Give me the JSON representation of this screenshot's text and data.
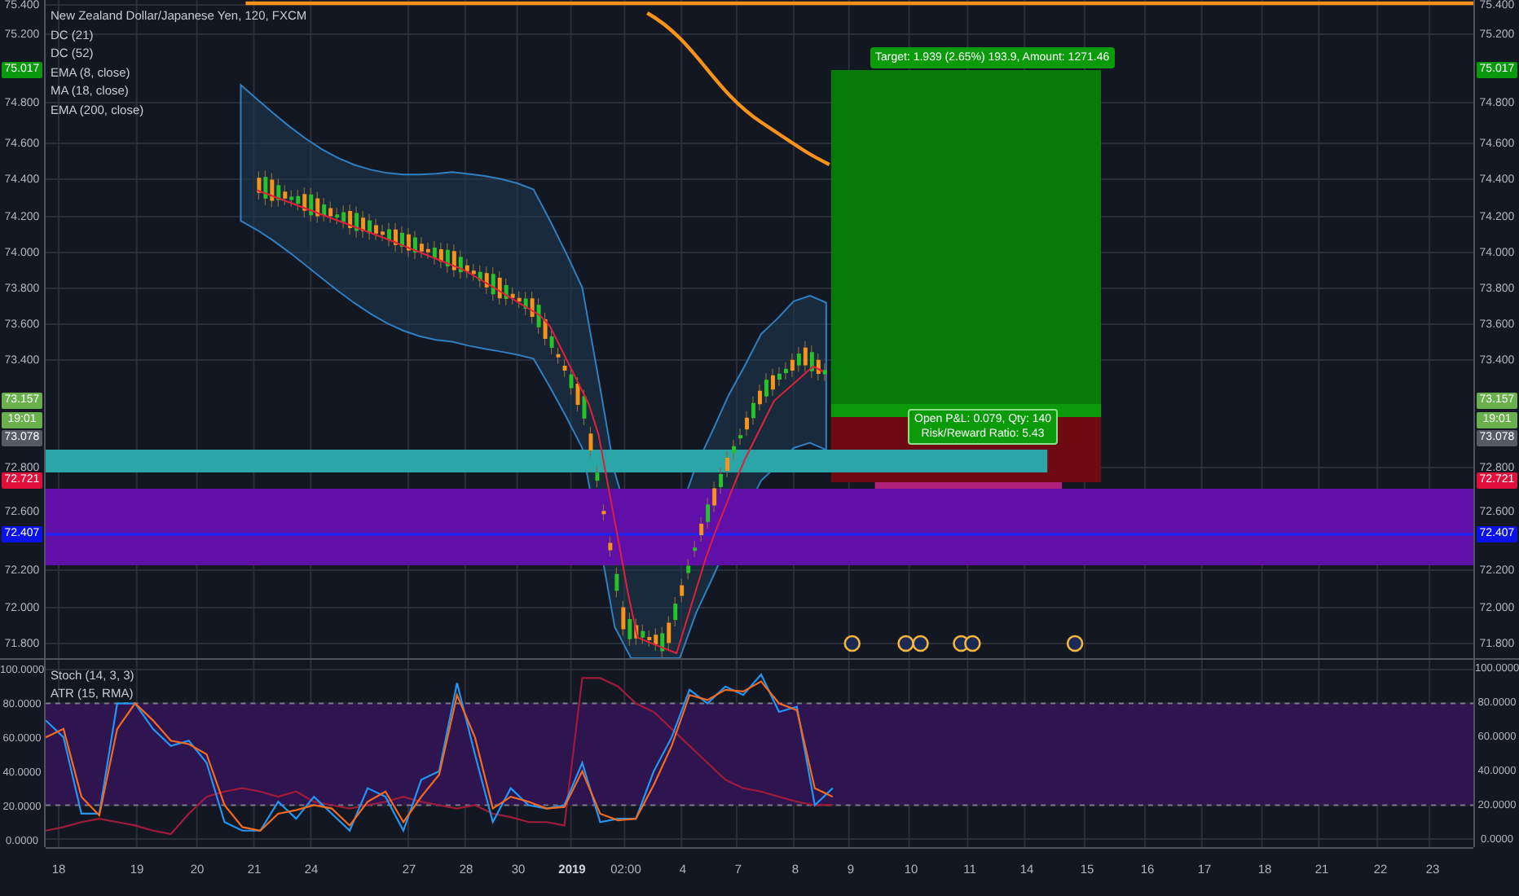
{
  "main_pane": {
    "legend": [
      "New Zealand Dollar/Japanese Yen, 120, FXCM",
      "DC (21)",
      "DC (52)",
      "EMA (8, close)",
      "MA (18, close)",
      "EMA (200, close)"
    ],
    "left_axis_ticks": [
      "75.400",
      "75.200",
      "74.800",
      "74.600",
      "74.400",
      "74.200",
      "74.000",
      "73.800",
      "73.600",
      "73.400",
      "72.800",
      "72.600",
      "72.200",
      "72.000",
      "71.800"
    ],
    "right_axis_ticks": [
      "75.400",
      "75.200",
      "74.800",
      "74.600",
      "74.400",
      "74.200",
      "74.000",
      "73.800",
      "73.600",
      "73.400",
      "72.800",
      "72.600",
      "72.200",
      "72.000",
      "71.800"
    ],
    "left_badges": [
      {
        "text": "75.017",
        "color": "#089a0c"
      },
      {
        "text": "73.157",
        "color": "#6ab04c"
      },
      {
        "text": "19:01",
        "color": "#6ab04c"
      },
      {
        "text": "73.078",
        "color": "#555a63"
      },
      {
        "text": "72.721",
        "color": "#e0103a"
      },
      {
        "text": "72.407",
        "color": "#0a12e8"
      }
    ],
    "right_badges": [
      {
        "text": "75.017",
        "color": "#089a0c"
      },
      {
        "text": "73.157",
        "color": "#6ab04c"
      },
      {
        "text": "19:01",
        "color": "#6ab04c"
      },
      {
        "text": "73.078",
        "color": "#555a63"
      },
      {
        "text": "72.721",
        "color": "#e0103a"
      },
      {
        "text": "72.407",
        "color": "#0a12e8"
      }
    ],
    "position_tool": {
      "target_label": "Target: 1.939 (2.65%) 193.9, Amount: 1271.46",
      "pnl_label": "Open P&L: 0.079, Qty: 140",
      "ratio_label": "Risk/Reward Ratio: 5.43"
    }
  },
  "oscillator_pane": {
    "legend": [
      "Stoch (14, 3, 3)",
      "ATR (15, RMA)"
    ],
    "left_axis_ticks": [
      "100.0000",
      "80.0000",
      "60.0000",
      "40.0000",
      "20.0000",
      "0.0000"
    ],
    "chart_data": {
      "type": "line",
      "grid": true,
      "ylim": [
        0,
        100
      ],
      "yticks": [
        {
          "value": 100,
          "label": "100.0000"
        },
        {
          "value": 80,
          "label": "80.0000"
        },
        {
          "value": 60,
          "label": "60.0000"
        },
        {
          "value": 40,
          "label": "40.0000"
        },
        {
          "value": 20,
          "label": "20.0000"
        },
        {
          "value": 0,
          "label": "0.0000"
        }
      ],
      "series": [
        {
          "color": "#2196f3",
          "values": [
            70,
            60,
            15,
            15,
            80,
            80,
            65,
            55,
            58,
            45,
            10,
            5,
            5,
            22,
            12,
            25,
            15,
            5,
            30,
            25,
            5,
            35,
            40,
            92,
            50,
            10,
            30,
            20,
            18,
            20,
            45,
            10,
            12,
            12,
            40,
            60,
            88,
            80,
            90,
            85,
            97,
            75,
            78,
            20,
            30
          ]
        },
        {
          "color": "#f36a21",
          "values": [
            60,
            65,
            25,
            14,
            65,
            80,
            70,
            58,
            56,
            50,
            20,
            7,
            5,
            15,
            17,
            20,
            18,
            8,
            22,
            28,
            10,
            25,
            38,
            85,
            60,
            18,
            25,
            22,
            18,
            19,
            40,
            15,
            11,
            12,
            32,
            55,
            85,
            82,
            88,
            87,
            93,
            80,
            76,
            30,
            25
          ]
        },
        {
          "color": "#a01b3a",
          "values": [
            5,
            7,
            10,
            12,
            10,
            8,
            5,
            3,
            15,
            25,
            28,
            30,
            28,
            25,
            28,
            22,
            20,
            18,
            20,
            22,
            25,
            22,
            20,
            18,
            20,
            15,
            13,
            10,
            10,
            8,
            95,
            95,
            90,
            80,
            75,
            65,
            55,
            45,
            35,
            30,
            28,
            25,
            22,
            20,
            20
          ]
        }
      ]
    }
  },
  "time_axis": [
    "18",
    "19",
    "20",
    "21",
    "24",
    "27",
    "28",
    "30",
    "2019",
    "02:00",
    "4",
    "7",
    "8",
    "9",
    "10",
    "11",
    "14",
    "15",
    "16",
    "17",
    "18",
    "21",
    "22",
    "23"
  ]
}
